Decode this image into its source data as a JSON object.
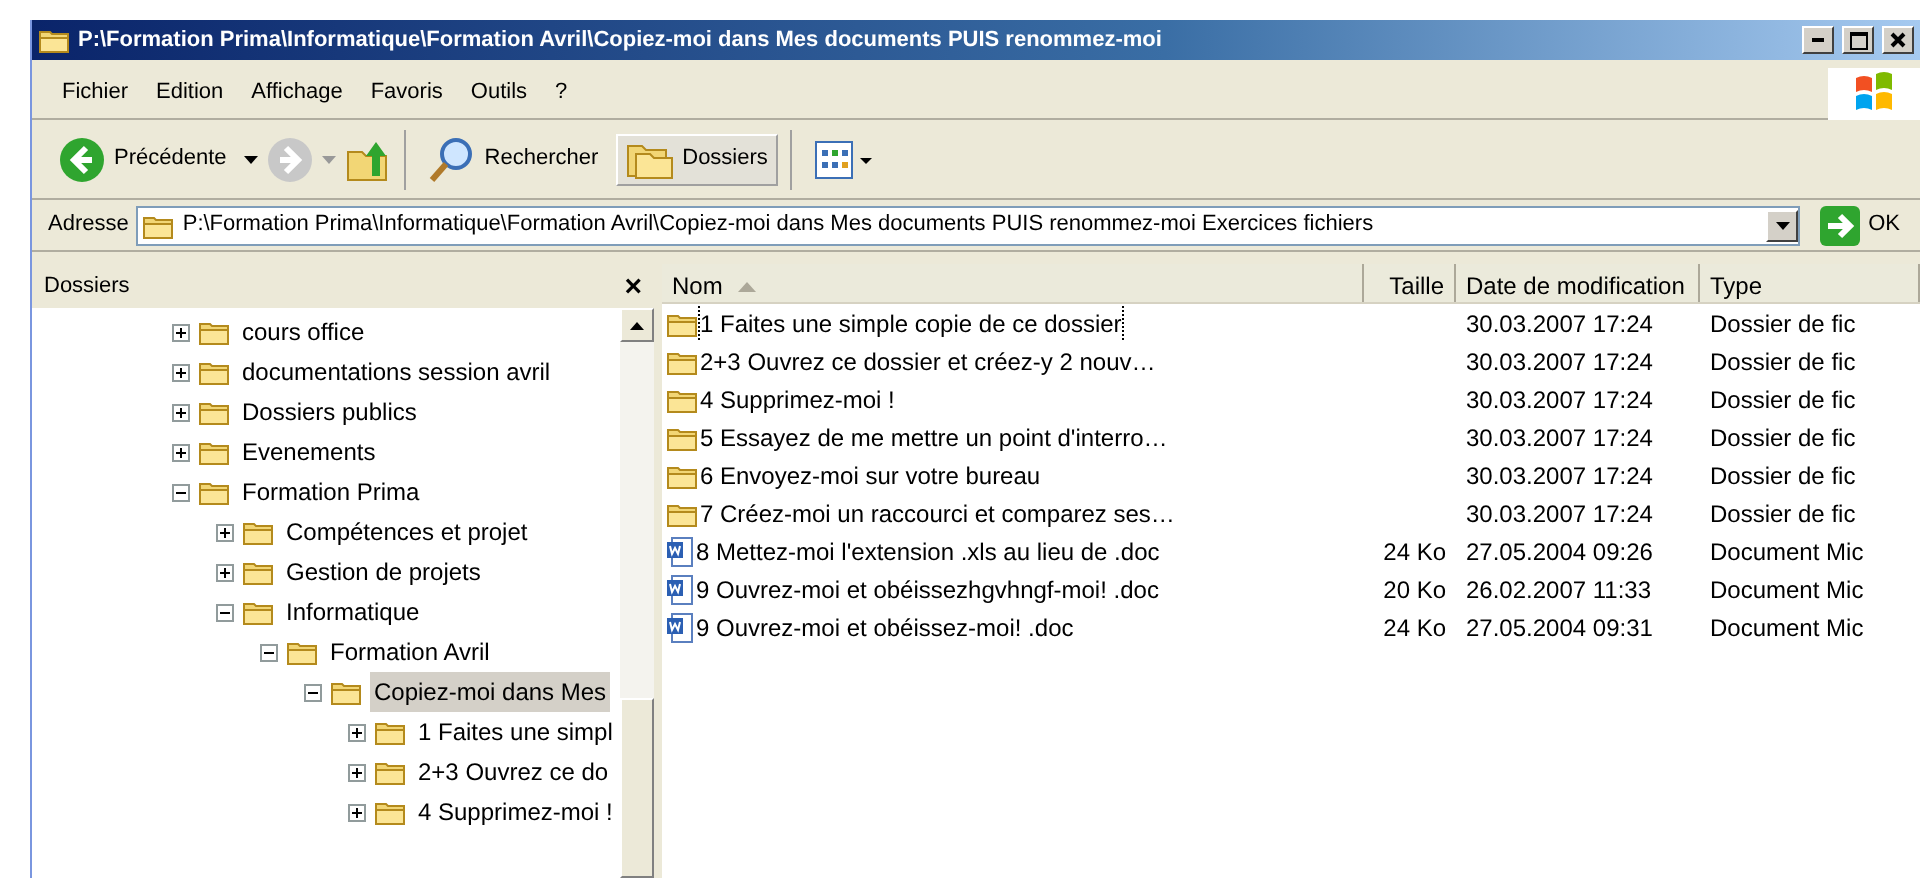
{
  "window": {
    "title": "P:\\Formation Prima\\Informatique\\Formation Avril\\Copiez-moi dans Mes documents PUIS renommez-moi"
  },
  "menu": [
    "Fichier",
    "Edition",
    "Affichage",
    "Favoris",
    "Outils",
    "?"
  ],
  "toolbar": {
    "back": "Précédente",
    "search": "Rechercher",
    "folders": {
      "label": "Dossiers",
      "selected": true
    }
  },
  "address": {
    "label": "Adresse",
    "value": "P:\\Formation Prima\\Informatique\\Formation Avril\\Copiez-moi dans Mes documents PUIS renommez-moi Exercices fichiers",
    "go": "OK"
  },
  "sidebar": {
    "title": "Dossiers",
    "close": "×",
    "items": [
      {
        "label": "cours office",
        "expanded": false,
        "selected": false
      },
      {
        "label": "documentations session avril",
        "expanded": false,
        "selected": false
      },
      {
        "label": "Dossiers publics",
        "expanded": false,
        "selected": false
      },
      {
        "label": "Evenements",
        "expanded": false,
        "selected": false
      },
      {
        "label": "Formation Prima",
        "expanded": true,
        "selected": false,
        "children": [
          {
            "label": "Compétences et projet",
            "expanded": false,
            "selected": false
          },
          {
            "label": "Gestion de projets",
            "expanded": false,
            "selected": false
          },
          {
            "label": "Informatique",
            "expanded": true,
            "selected": false,
            "children": [
              {
                "label": "Formation Avril",
                "expanded": true,
                "selected": false,
                "children": [
                  {
                    "label": "Copiez-moi dans Mes",
                    "expanded": true,
                    "selected": true,
                    "children": [
                      {
                        "label": "1 Faites une simpl",
                        "expanded": false,
                        "selected": false
                      },
                      {
                        "label": "2+3 Ouvrez ce do",
                        "expanded": false,
                        "selected": false
                      },
                      {
                        "label": "4 Supprimez-moi !",
                        "expanded": false,
                        "selected": false
                      }
                    ]
                  }
                ]
              }
            ]
          }
        ]
      }
    ]
  },
  "table": {
    "columns": [
      "Nom",
      "Taille",
      "Date de modification",
      "Type"
    ],
    "rows": [
      {
        "kind": "folder",
        "name": "1 Faites une simple copie de ce dossier",
        "size": "",
        "date": "30.03.2007 17:24",
        "type": "Dossier de fic",
        "focused": true
      },
      {
        "kind": "folder",
        "name": "2+3 Ouvrez ce dossier et créez-y 2 nouv…",
        "size": "",
        "date": "30.03.2007 17:24",
        "type": "Dossier de fic",
        "focused": false
      },
      {
        "kind": "folder",
        "name": "4 Supprimez-moi !",
        "size": "",
        "date": "30.03.2007 17:24",
        "type": "Dossier de fic",
        "focused": false
      },
      {
        "kind": "folder",
        "name": "5 Essayez de me mettre un point d'interro…",
        "size": "",
        "date": "30.03.2007 17:24",
        "type": "Dossier de fic",
        "focused": false
      },
      {
        "kind": "folder",
        "name": "6 Envoyez-moi sur votre bureau",
        "size": "",
        "date": "30.03.2007 17:24",
        "type": "Dossier de fic",
        "focused": false
      },
      {
        "kind": "folder",
        "name": "7 Créez-moi un raccourci et comparez ses…",
        "size": "",
        "date": "30.03.2007 17:24",
        "type": "Dossier de fic",
        "focused": false
      },
      {
        "kind": "document",
        "name": "8 Mettez-moi l'extension .xls au lieu de .doc",
        "size": "24 Ko",
        "date": "27.05.2004 09:26",
        "type": "Document Mic",
        "focused": false
      },
      {
        "kind": "document",
        "name": "9 Ouvrez-moi et obéissezhgvhngf-moi! .doc",
        "size": "20 Ko",
        "date": "26.02.2007 11:33",
        "type": "Document Mic",
        "focused": false
      },
      {
        "kind": "document",
        "name": "9 Ouvrez-moi et obéissez-moi! .doc",
        "size": "24 Ko",
        "date": "27.05.2004 09:31",
        "type": "Document Mic",
        "focused": false
      }
    ]
  }
}
